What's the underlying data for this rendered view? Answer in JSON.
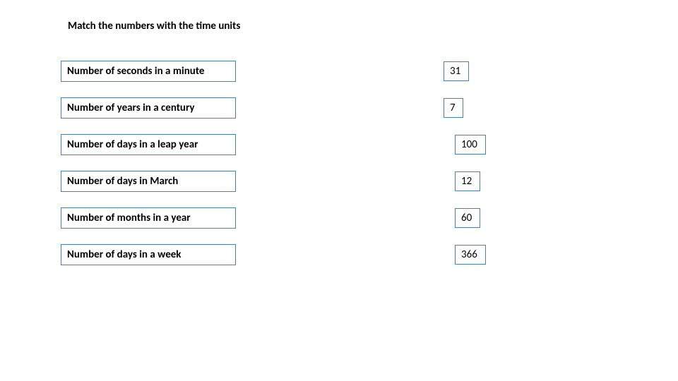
{
  "title": "Match the numbers with the time units",
  "prompts": [
    "Number of seconds in a minute",
    "Number of years in a century",
    "Number of days in a leap year",
    "Number of days in March",
    "Number of months in a year",
    "Number of days in a week"
  ],
  "answers": [
    "31",
    "7",
    "100",
    "12",
    "60",
    "366"
  ]
}
